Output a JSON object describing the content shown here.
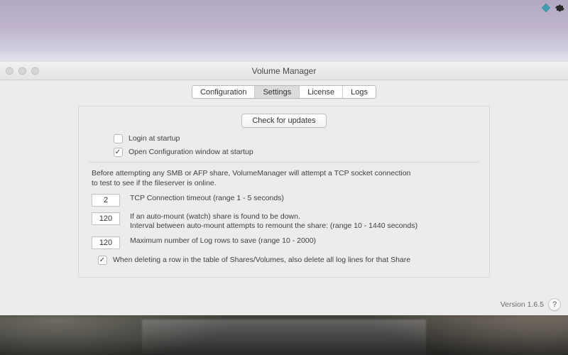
{
  "window_title": "Volume Manager",
  "tabs": {
    "items": [
      "Configuration",
      "Settings",
      "License",
      "Logs"
    ],
    "active_index": 1
  },
  "settings": {
    "check_updates_label": "Check for updates",
    "login_at_startup": {
      "label": "Login at startup",
      "checked": false
    },
    "open_config_at_startup": {
      "label": "Open Configuration window at startup",
      "checked": true
    },
    "explain_line1": "Before attempting any SMB or AFP share, VolumeManager will attempt a TCP socket connection",
    "explain_line2": "to test to see if the fileserver is online.",
    "tcp_timeout": {
      "value": "2",
      "label": "TCP Connection timeout (range 1 - 5 seconds)"
    },
    "remount_interval": {
      "value": "120",
      "label_line1": "If an auto-mount (watch) share is found to be down.",
      "label_line2": "Interval between auto-mount attempts to remount the share:  (range 10 - 1440 seconds)"
    },
    "max_log_rows": {
      "value": "120",
      "label": "Maximum number of Log rows to save (range 10 - 2000)"
    },
    "delete_log_on_row_delete": {
      "label": "When deleting a row in the table of Shares/Volumes, also delete all log lines for that Share",
      "checked": true
    }
  },
  "footer": {
    "version_label": "Version 1.6.5",
    "help_label": "?"
  }
}
